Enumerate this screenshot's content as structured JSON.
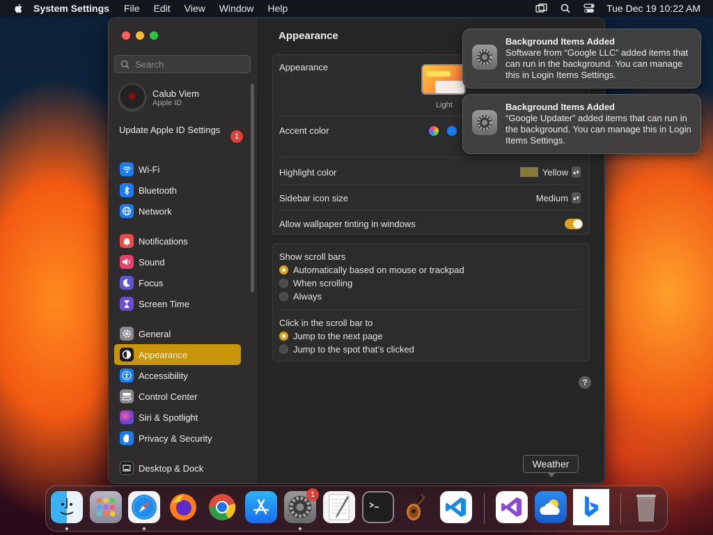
{
  "menubar": {
    "app_name": "System Settings",
    "menus": [
      "File",
      "Edit",
      "View",
      "Window",
      "Help"
    ],
    "clock": "Tue Dec 19  10:22 AM"
  },
  "sidebar": {
    "search_placeholder": "Search",
    "profile": {
      "name": "Calub Viem",
      "subtitle": "Apple ID"
    },
    "update": {
      "label": "Update Apple ID Settings",
      "badge": "1"
    },
    "items": [
      {
        "label": "Wi-Fi",
        "icon": "wifi-icon",
        "color": "#1a7cf5"
      },
      {
        "label": "Bluetooth",
        "icon": "bluetooth-icon",
        "color": "#1a7cf5"
      },
      {
        "label": "Network",
        "icon": "globe-icon",
        "color": "#1a7cf5"
      },
      {
        "label": "Notifications",
        "icon": "bell-icon",
        "color": "#ea4b43"
      },
      {
        "label": "Sound",
        "icon": "speaker-icon",
        "color": "#ea3e6c"
      },
      {
        "label": "Focus",
        "icon": "moon-icon",
        "color": "#5e55d6"
      },
      {
        "label": "Screen Time",
        "icon": "hourglass-icon",
        "color": "#6a4fd6"
      },
      {
        "label": "General",
        "icon": "gear-icon",
        "color": "#8a8a8e"
      },
      {
        "label": "Appearance",
        "icon": "appearance-icon",
        "color": "#1c1c1c"
      },
      {
        "label": "Accessibility",
        "icon": "accessibility-icon",
        "color": "#1a7cf5"
      },
      {
        "label": "Control Center",
        "icon": "control-center-icon",
        "color": "#8a8a8e"
      },
      {
        "label": "Siri & Spotlight",
        "icon": "siri-icon",
        "color": "#6d3dc9"
      },
      {
        "label": "Privacy & Security",
        "icon": "hand-icon",
        "color": "#1a7cf5"
      },
      {
        "label": "Desktop & Dock",
        "icon": "dock-icon",
        "color": "#1c1c1c"
      }
    ],
    "selected": "Appearance"
  },
  "content": {
    "title": "Appearance",
    "appearance_label": "Appearance",
    "light_label": "Light",
    "accent_label": "Accent color",
    "highlight_label": "Highlight color",
    "highlight_value": "Yellow",
    "sidebar_icon_label": "Sidebar icon size",
    "sidebar_icon_value": "Medium",
    "tinting_label": "Allow wallpaper tinting in windows",
    "tinting_on": true,
    "scroll_bars": {
      "heading": "Show scroll bars",
      "options": [
        "Automatically based on mouse or trackpad",
        "When scrolling",
        "Always"
      ],
      "selected": 0
    },
    "click_scroll": {
      "heading": "Click in the scroll bar to",
      "options": [
        "Jump to the next page",
        "Jump to the spot that’s clicked"
      ],
      "selected": 0
    },
    "help": "?"
  },
  "notifications": [
    {
      "title": "Background Items Added",
      "body": "Software from “Google LLC” added items that can run in the background. You can manage this in Login Items Settings."
    },
    {
      "title": "Background Items Added",
      "body": "“Google Updater” added items that can run in the background. You can manage this in Login Items Settings."
    }
  ],
  "tooltip": "Weather",
  "dock": {
    "apps": [
      "Finder",
      "Launchpad",
      "Safari",
      "Firefox",
      "Chrome",
      "App Store",
      "System Settings",
      "TextEdit",
      "Terminal",
      "GarageBand",
      "Visual Studio Code",
      "Visual Studio",
      "Weather",
      "Bing",
      "Trash"
    ],
    "settings_badge": "1"
  }
}
